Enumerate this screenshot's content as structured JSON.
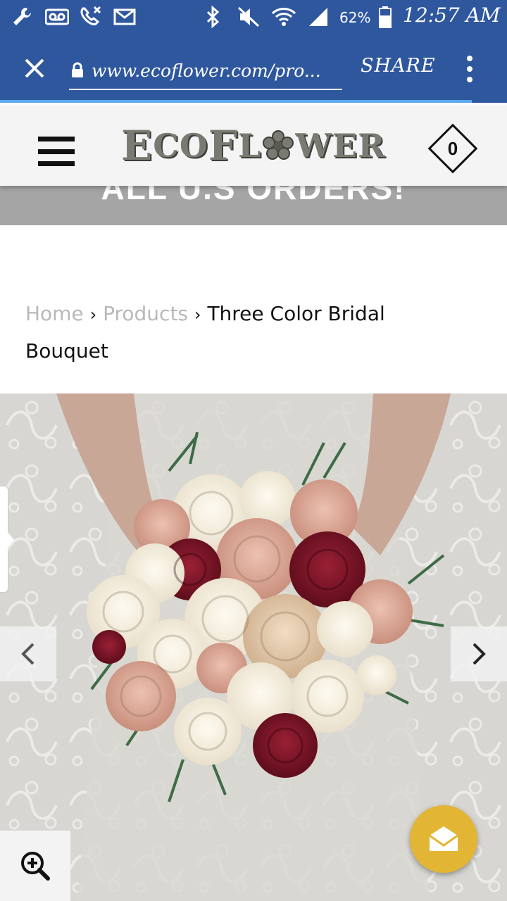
{
  "status_bar": {
    "battery": "62%",
    "time": "12:57 AM",
    "icons": [
      "wrench-icon",
      "voicemail-icon",
      "missed-call-icon",
      "email-icon",
      "bluetooth-icon",
      "mute-icon",
      "wifi-icon",
      "signal-icon",
      "battery-icon"
    ]
  },
  "browser": {
    "url": "www.ecoflower.com/pro...",
    "share_label": "SHARE",
    "icons": [
      "close-icon",
      "lock-icon",
      "overflow-menu-icon"
    ],
    "theme_color": "#2f579e"
  },
  "header": {
    "logo_text_1": "ECO",
    "logo_text_2": "FL",
    "logo_text_3": "WER",
    "cart_count": "0",
    "icons": [
      "hamburger-menu-icon",
      "cart-icon"
    ]
  },
  "banner": {
    "partial_text": "ALL U.S ORDERS!"
  },
  "breadcrumb": {
    "home": "Home",
    "separator": "›",
    "products": "Products",
    "current": "Three Color Bridal Bouquet"
  },
  "product_image": {
    "icons": [
      "chevron-left-icon",
      "chevron-right-icon",
      "zoom-in-icon",
      "chat-icon"
    ],
    "accent_color": "#e3b534"
  }
}
